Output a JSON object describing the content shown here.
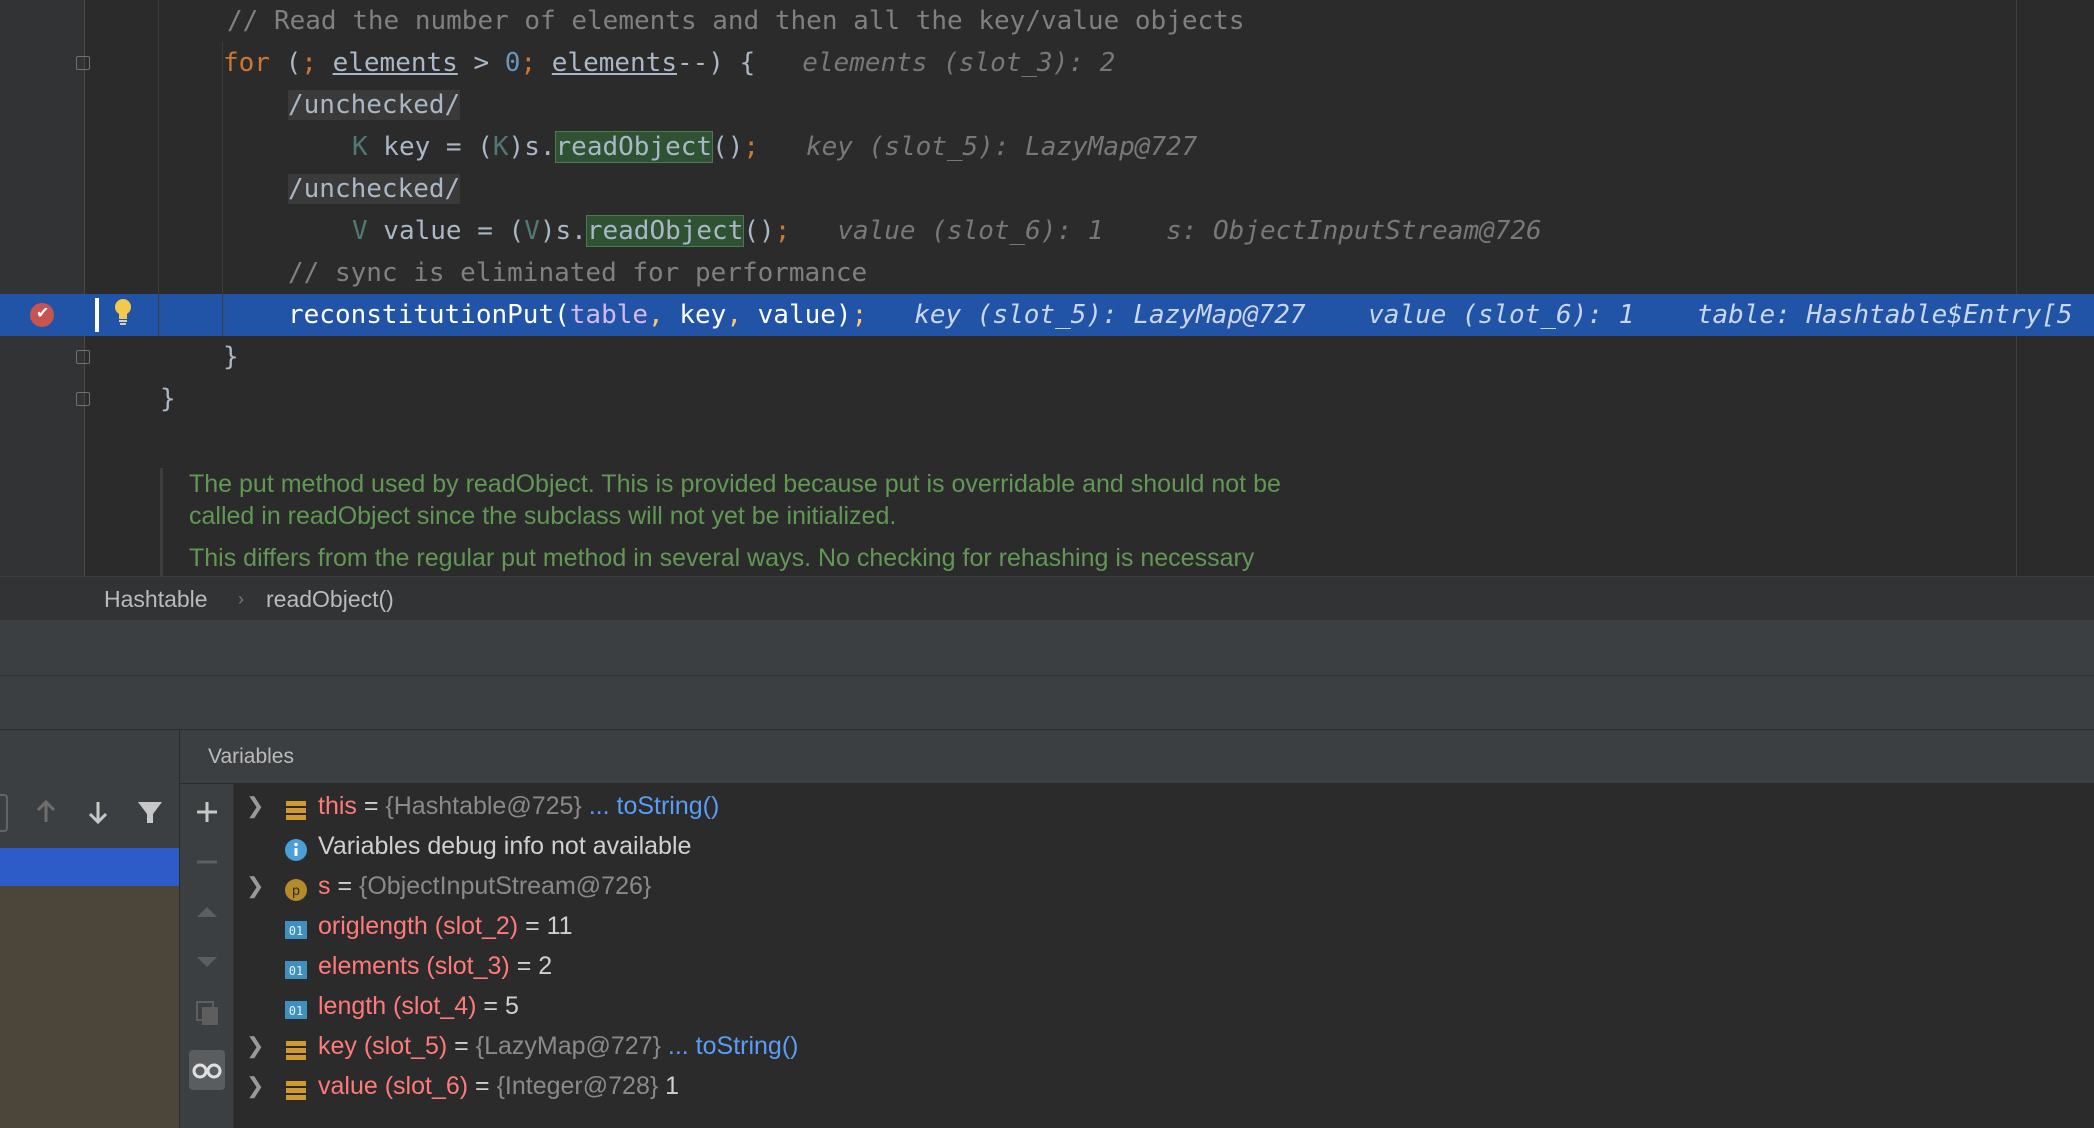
{
  "editor": {
    "lines": [
      {
        "segments": [
          {
            "t": "// Read the number of elements and then all the key/value objects",
            "c": "cm"
          }
        ]
      },
      {
        "segments": [
          {
            "t": "for",
            "c": "kw"
          },
          {
            "t": " ("
          },
          {
            "t": ";",
            "c": "pu"
          },
          {
            "t": " "
          },
          {
            "t": "elements",
            "c": "under"
          },
          {
            "t": " > "
          },
          {
            "t": "0",
            "c": "num"
          },
          {
            "t": ";",
            "c": "pu"
          },
          {
            "t": " "
          },
          {
            "t": "elements",
            "c": "under"
          },
          {
            "t": "--) {   "
          },
          {
            "t": "elements (slot_3): 2",
            "c": "hint"
          }
        ]
      },
      {
        "segments": [
          {
            "t": "/unchecked/",
            "c": "gen"
          }
        ]
      },
      {
        "segments": [
          {
            "t": "K",
            "c": "tp"
          },
          {
            "t": " key = ("
          },
          {
            "t": "K",
            "c": "tp"
          },
          {
            "t": ")s."
          },
          {
            "t": "readObject",
            "c": "match"
          },
          {
            "t": "()"
          },
          {
            "t": ";",
            "c": "pu"
          },
          {
            "t": "   "
          },
          {
            "t": "key (slot_5): LazyMap@727",
            "c": "hint"
          }
        ]
      },
      {
        "segments": [
          {
            "t": "/unchecked/",
            "c": "gen"
          }
        ]
      },
      {
        "segments": [
          {
            "t": "V",
            "c": "tp"
          },
          {
            "t": " value = ("
          },
          {
            "t": "V",
            "c": "tp"
          },
          {
            "t": ")s."
          },
          {
            "t": "readObject",
            "c": "match"
          },
          {
            "t": "()"
          },
          {
            "t": ";",
            "c": "pu"
          },
          {
            "t": "   "
          },
          {
            "t": "value (slot_6): 1    s: ObjectInputStream@726",
            "c": "hint"
          }
        ]
      },
      {
        "segments": [
          {
            "t": "// sync is eliminated for performance",
            "c": "cm"
          }
        ]
      },
      {
        "segments": [
          {
            "t": "reconstitutionPut("
          },
          {
            "t": "table",
            "c": "fld"
          },
          {
            "t": ",",
            "c": "pu"
          },
          {
            "t": " key"
          },
          {
            "t": ",",
            "c": "pu"
          },
          {
            "t": " value)"
          },
          {
            "t": ";",
            "c": "pu"
          },
          {
            "t": "   "
          },
          {
            "t": "key (slot_5): LazyMap@727    value (slot_6): 1    table: Hashtable$Entry[5",
            "c": "hint"
          }
        ]
      },
      {
        "segments": [
          {
            "t": "}"
          }
        ]
      },
      {
        "segments": [
          {
            "t": "}"
          }
        ]
      }
    ],
    "doc": {
      "line1": "The put method used by readObject. This is provided because put is overridable and should not be",
      "line2": "called in readObject since the subclass will not yet be initialized.",
      "line3": "This differs from the regular put method in several ways. No checking for rehashing is necessary"
    }
  },
  "breadcrumb": {
    "class_name": "Hashtable",
    "separator": "›",
    "method_name": "readObject()"
  },
  "frames_pane": {
    "toolbar": [
      "arrow-up-icon",
      "arrow-down-icon",
      "filter-icon"
    ]
  },
  "variables": {
    "title": "Variables",
    "side_toolbar": [
      "add-icon",
      "remove-icon",
      "move-up-icon",
      "move-down-icon",
      "copy-icon",
      "watch-glasses-icon"
    ],
    "rows": [
      {
        "expandable": true,
        "icon": "field",
        "name": "this",
        "eq": " = ",
        "type": "{Hashtable@725}",
        "value": "",
        "link": " ... toString()"
      },
      {
        "expandable": false,
        "icon": "info",
        "info": "Variables debug info not available"
      },
      {
        "expandable": true,
        "icon": "param",
        "name": "s",
        "eq": " = ",
        "type": "{ObjectInputStream@726}",
        "value": "",
        "link": ""
      },
      {
        "expandable": false,
        "icon": "prim",
        "name": "origlength (slot_2)",
        "eq": " = ",
        "type": "",
        "value": "11",
        "link": ""
      },
      {
        "expandable": false,
        "icon": "prim",
        "name": "elements (slot_3)",
        "eq": " = ",
        "type": "",
        "value": "2",
        "link": ""
      },
      {
        "expandable": false,
        "icon": "prim",
        "name": "length (slot_4)",
        "eq": " = ",
        "type": "",
        "value": "5",
        "link": ""
      },
      {
        "expandable": true,
        "icon": "field",
        "name": "key (slot_5)",
        "eq": " = ",
        "type": "{LazyMap@727}",
        "value": "",
        "link": " ... toString()"
      },
      {
        "expandable": true,
        "icon": "field",
        "name": "value (slot_6)",
        "eq": " = ",
        "type": "{Integer@728}",
        "value": " 1",
        "link": ""
      }
    ]
  },
  "colors": {
    "editor_bg": "#2b2b2b",
    "execution_line": "#2154a6",
    "breakpoint": "#c75450",
    "keyword": "#cc7832",
    "comment": "#808080",
    "doc_comment": "#629755",
    "variable_name": "#ff7a7a",
    "link": "#589df6"
  }
}
